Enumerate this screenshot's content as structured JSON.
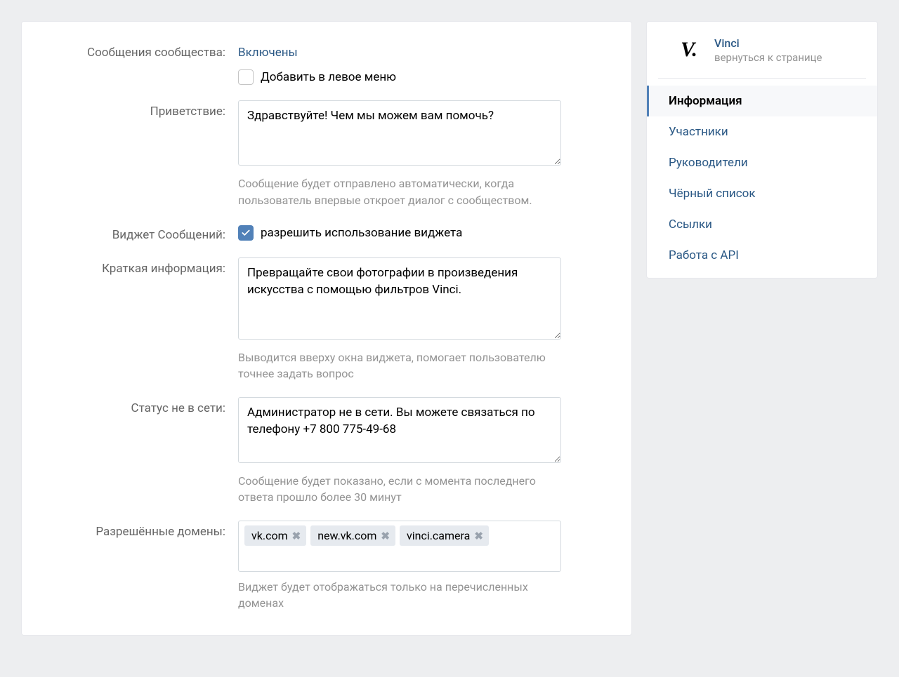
{
  "community": {
    "name": "Vinci",
    "back_link": "вернуться к странице"
  },
  "nav": {
    "items": [
      {
        "label": "Информация",
        "active": true
      },
      {
        "label": "Участники",
        "active": false
      },
      {
        "label": "Руководители",
        "active": false
      },
      {
        "label": "Чёрный список",
        "active": false
      },
      {
        "label": "Ссылки",
        "active": false
      },
      {
        "label": "Работа с API",
        "active": false
      }
    ]
  },
  "form": {
    "messages": {
      "label": "Сообщения сообщества:",
      "value": "Включены",
      "add_to_menu_label": "Добавить в левое меню",
      "add_to_menu_checked": false
    },
    "greeting": {
      "label": "Приветствие:",
      "value": "Здравствуйте! Чем мы можем вам помочь?",
      "hint": "Сообщение будет отправлено автоматически, когда пользователь впервые откроет диалог с сообществом."
    },
    "widget": {
      "label": "Виджет Сообщений:",
      "allow_label": "разрешить использование виджета",
      "allow_checked": true
    },
    "short_info": {
      "label": "Краткая информация:",
      "value": "Превращайте свои фотографии в произведения искусства с помощью фильтров Vinci.",
      "hint": "Выводится вверху окна виджета, помогает пользователю точнее задать вопрос"
    },
    "offline_status": {
      "label": "Статус не в сети:",
      "value": "Администратор не в сети. Вы можете связаться по телефону +7 800 775-49-68",
      "hint": "Сообщение будет показано, если с момента последнего ответа прошло более 30 минут"
    },
    "domains": {
      "label": "Разрешённые домены:",
      "items": [
        "vk.com",
        "new.vk.com",
        "vinci.camera"
      ],
      "hint": "Виджет будет отображаться только на перечисленных доменах"
    }
  }
}
